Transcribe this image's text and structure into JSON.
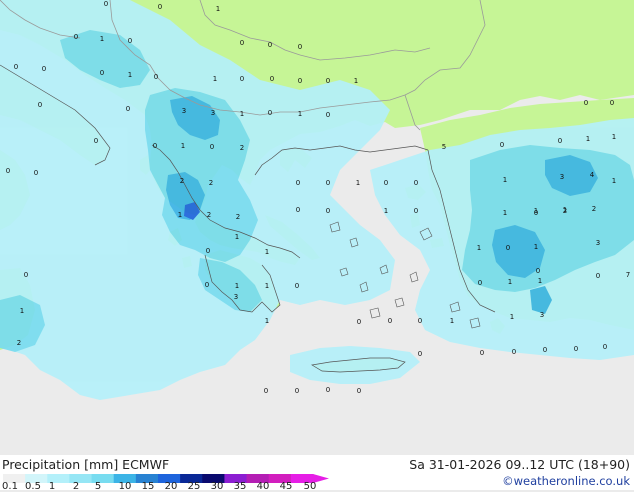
{
  "header": {
    "title": "Precipitation [mm] ECMWF",
    "datetime": "Sa 31-01-2026 09..12 UTC (18+90)",
    "credit": "©weatheronline.co.uk"
  },
  "colors": {
    "sea": "#ebebeb",
    "land": "#c6f596",
    "precip_light": "#b4f0fa",
    "precip_medium": "#78dcf0",
    "precip_heavy": "#3cb4e6",
    "precip_max": "#1e64dc",
    "border": "#9a9a9a",
    "coast": "#555555"
  },
  "legend": {
    "ticks": [
      "0.1",
      "0.5",
      "1",
      "2",
      "5",
      "10",
      "15",
      "20",
      "25",
      "30",
      "35",
      "40",
      "45",
      "50"
    ],
    "colors": [
      "#f0f0f0",
      "#d2f5fa",
      "#b4f0fa",
      "#96e6f5",
      "#78dcf0",
      "#3cb4e6",
      "#2882d2",
      "#1e64dc",
      "#0a2896",
      "#0a0a6e",
      "#8c1ed2",
      "#b41eb4",
      "#d21ebe",
      "#e61ee6"
    ]
  },
  "values": [
    {
      "t": "0"
    },
    {
      "t": "1"
    },
    {
      "t": "0"
    },
    {
      "t": "0"
    },
    {
      "t": "0"
    },
    {
      "t": "0"
    },
    {
      "t": "0"
    },
    {
      "t": "1"
    },
    {
      "t": "0"
    },
    {
      "t": "0"
    },
    {
      "t": "0"
    },
    {
      "t": "0"
    },
    {
      "t": "1"
    },
    {
      "t": "0"
    },
    {
      "t": "1"
    },
    {
      "t": "0"
    },
    {
      "t": "0"
    },
    {
      "t": "0"
    },
    {
      "t": "0"
    },
    {
      "t": "1"
    },
    {
      "t": "0"
    },
    {
      "t": "0"
    },
    {
      "t": "3"
    },
    {
      "t": "3"
    },
    {
      "t": "1"
    },
    {
      "t": "0"
    },
    {
      "t": "1"
    },
    {
      "t": "0"
    },
    {
      "t": "0"
    },
    {
      "t": "0"
    },
    {
      "t": "0"
    },
    {
      "t": "0"
    },
    {
      "t": "1"
    },
    {
      "t": "0"
    },
    {
      "t": "2"
    },
    {
      "t": "5"
    },
    {
      "t": "0"
    },
    {
      "t": "0"
    },
    {
      "t": "1"
    },
    {
      "t": "1"
    },
    {
      "t": "0"
    },
    {
      "t": "0"
    },
    {
      "t": "0"
    },
    {
      "t": "0"
    },
    {
      "t": "0"
    },
    {
      "t": "0"
    },
    {
      "t": "1"
    },
    {
      "t": "1"
    },
    {
      "t": "3"
    },
    {
      "t": "4"
    },
    {
      "t": "1"
    },
    {
      "t": "2"
    },
    {
      "t": "2"
    },
    {
      "t": "0"
    },
    {
      "t": "0"
    },
    {
      "t": "1"
    },
    {
      "t": "0"
    },
    {
      "t": "1"
    },
    {
      "t": "0"
    },
    {
      "t": "1"
    },
    {
      "t": "2"
    },
    {
      "t": "2"
    },
    {
      "t": "1"
    },
    {
      "t": "1"
    },
    {
      "t": "2"
    },
    {
      "t": "2"
    },
    {
      "t": "1"
    },
    {
      "t": "0"
    },
    {
      "t": "1"
    },
    {
      "t": "1"
    },
    {
      "t": "0"
    },
    {
      "t": "1"
    },
    {
      "t": "3"
    },
    {
      "t": "0"
    },
    {
      "t": "0"
    },
    {
      "t": "1"
    },
    {
      "t": "1"
    },
    {
      "t": "0"
    },
    {
      "t": "0"
    },
    {
      "t": "0"
    },
    {
      "t": "7"
    },
    {
      "t": "0"
    },
    {
      "t": "1"
    },
    {
      "t": "1"
    },
    {
      "t": "3"
    },
    {
      "t": "1"
    },
    {
      "t": "1"
    },
    {
      "t": "2"
    },
    {
      "t": "1"
    },
    {
      "t": "0"
    },
    {
      "t": "0"
    },
    {
      "t": "0"
    },
    {
      "t": "1"
    },
    {
      "t": "3"
    },
    {
      "t": "0"
    },
    {
      "t": "0"
    },
    {
      "t": "0"
    },
    {
      "t": "0"
    },
    {
      "t": "0"
    },
    {
      "t": "0"
    },
    {
      "t": "0"
    },
    {
      "t": "0"
    },
    {
      "t": "0"
    },
    {
      "t": "0"
    }
  ]
}
